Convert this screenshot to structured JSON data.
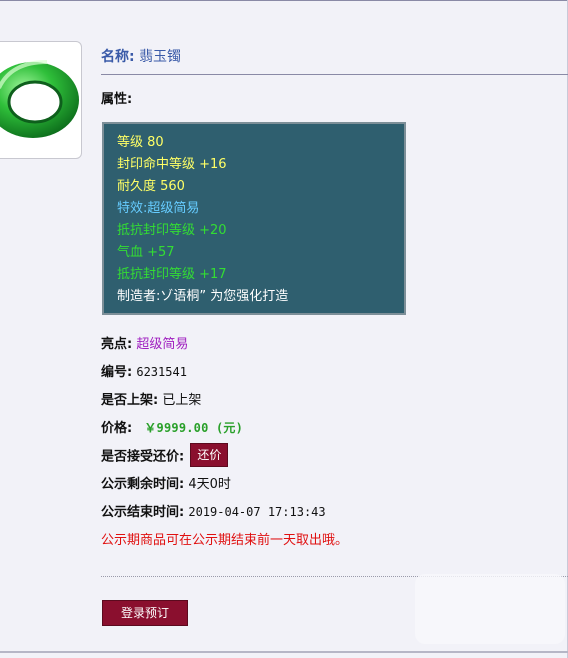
{
  "item": {
    "name_label": "名称:",
    "name_value": "翡玉镯",
    "attributes_title": "属性:",
    "attributes": [
      {
        "text": "等级 80",
        "color": "#ffff66"
      },
      {
        "text": "封印命中等级 +16",
        "color": "#ffff66"
      },
      {
        "text": "耐久度 560",
        "color": "#ffff66"
      },
      {
        "text": "特效:超级简易",
        "color": "#66ccff"
      },
      {
        "text": "抵抗封印等级 +20",
        "color": "#33dd33"
      },
      {
        "text": "气血 +57",
        "color": "#33dd33"
      },
      {
        "text": "抵抗封印等级 +17",
        "color": "#33dd33"
      },
      {
        "text": "制造者:ゾ语桐” 为您强化打造",
        "color": "#ffffff"
      }
    ],
    "highlight_label": "亮点:",
    "highlight_value": "超级简易",
    "serial_label": "编号:",
    "serial_value": "6231541",
    "listed_label": "是否上架:",
    "listed_value": "已上架",
    "price_label": "价格:",
    "price_value": "￥9999.00 (元)",
    "counteroffer_label": "是否接受还价:",
    "counteroffer_button": "还价",
    "remaining_label": "公示剩余时间:",
    "remaining_value": "4天0时",
    "end_label": "公示结束时间:",
    "end_value": "2019-04-07 17:13:43",
    "notice": "公示期商品可在公示期结束前一天取出哦。",
    "reserve_button": "登录预订"
  },
  "icon": "jade-bracelet-icon",
  "colors": {
    "accent": "#8a0f2e",
    "panel_bg": "#2f5f6f",
    "name_blue": "#3a5aa8",
    "highlight_purple": "#a020c0",
    "price_green": "#2aa02a",
    "notice_red": "#e01010"
  }
}
